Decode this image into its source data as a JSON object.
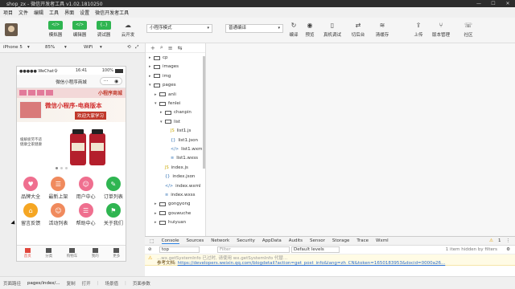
{
  "window": {
    "title": "shop_zx - 微信开发者工具 v1.02.1810250",
    "controls": [
      "—",
      "☐",
      "✕"
    ]
  },
  "menubar": [
    "项目",
    "文件",
    "编辑",
    "工具",
    "界面",
    "设置",
    "微信开发者工具"
  ],
  "toolbar": {
    "simulator": "模拟器",
    "editor": "编辑器",
    "debugger": "调试器",
    "cloud": "云开发",
    "mode_select": "小程序模式",
    "compile_select": "普通编译",
    "compile": "编译",
    "preview": "预览",
    "remote_debug": "真机调试",
    "background": "切后台",
    "clear_cache": "清缓存",
    "upload": "上传",
    "version": "版本管理",
    "community": "社区",
    "icons": {
      "simulator": "</>",
      "editor": "</>",
      "debugger": "{..}"
    }
  },
  "device_bar": {
    "device": "iPhone 5",
    "zoom": "85%",
    "network": "WiFi"
  },
  "phone": {
    "status_left": "●●●●● WeChat令",
    "status_time": "16:41",
    "status_right": "100%",
    "nav_title": "微信小程序商城",
    "banner_small": "小程序商城",
    "banner_title": "微信小程序-电商版本",
    "banner_button": "欢迎大家学习",
    "product_text": "缓解疲劳不适 健康全家健康",
    "grid": [
      {
        "label": "品牌大全",
        "color": "#ef6f8f",
        "glyph": "♥"
      },
      {
        "label": "最新上架",
        "color": "#f08a5d",
        "glyph": "☰"
      },
      {
        "label": "用户中心",
        "color": "#ef6f8f",
        "glyph": "☺"
      },
      {
        "label": "订单列表",
        "color": "#2fb551",
        "glyph": "✎"
      },
      {
        "label": "留言反馈",
        "color": "#f5a623",
        "glyph": "⌂"
      },
      {
        "label": "活动列表",
        "color": "#f08a5d",
        "glyph": "☺"
      },
      {
        "label": "帮助中心",
        "color": "#ef6f8f",
        "glyph": "☰"
      },
      {
        "label": "关于我们",
        "color": "#2fb551",
        "glyph": "⚑"
      }
    ],
    "tabs": [
      "首页",
      "分类",
      "购物车",
      "我的",
      "更多"
    ]
  },
  "filetree": {
    "tool_icons": [
      "+",
      "⌕",
      "≡",
      "⇆"
    ],
    "items": [
      {
        "label": "cp",
        "type": "folder",
        "caret": "▸",
        "indent": 0
      },
      {
        "label": "images",
        "type": "folder",
        "caret": "▸",
        "indent": 0
      },
      {
        "label": "img",
        "type": "folder",
        "caret": "▸",
        "indent": 0
      },
      {
        "label": "pages",
        "type": "folder",
        "caret": "▾",
        "indent": 0
      },
      {
        "label": "anli",
        "type": "folder",
        "caret": "▸",
        "indent": 1
      },
      {
        "label": "fenlei",
        "type": "folder",
        "caret": "▾",
        "indent": 1
      },
      {
        "label": "chanpin",
        "type": "folder",
        "caret": "▸",
        "indent": 2
      },
      {
        "label": "list",
        "type": "folder",
        "caret": "▾",
        "indent": 2
      },
      {
        "label": "list1.js",
        "type": "js",
        "caret": "",
        "indent": 3
      },
      {
        "label": "list1.json",
        "type": "json",
        "caret": "",
        "indent": 3
      },
      {
        "label": "list1.wxml",
        "type": "wxml",
        "caret": "",
        "indent": 3
      },
      {
        "label": "list1.wxss",
        "type": "wxss",
        "caret": "",
        "indent": 3
      },
      {
        "label": "index.js",
        "type": "js",
        "caret": "",
        "indent": 2
      },
      {
        "label": "index.json",
        "type": "json",
        "caret": "",
        "indent": 2
      },
      {
        "label": "index.wxml",
        "type": "wxml",
        "caret": "",
        "indent": 2
      },
      {
        "label": "index.wxss",
        "type": "wxss",
        "caret": "",
        "indent": 2
      },
      {
        "label": "gongyong",
        "type": "folder",
        "caret": "▸",
        "indent": 1
      },
      {
        "label": "gouwuche",
        "type": "folder",
        "caret": "▸",
        "indent": 1
      },
      {
        "label": "huiyuan",
        "type": "folder",
        "caret": "▸",
        "indent": 1
      }
    ]
  },
  "devtools": {
    "tabs": [
      "Console",
      "Sources",
      "Network",
      "Security",
      "AppData",
      "Audits",
      "Sensor",
      "Storage",
      "Trace",
      "Wxml"
    ],
    "active_tab": "Console",
    "warn_count": "1",
    "context": "top",
    "filter_placeholder": "Filter",
    "levels": "Default levels",
    "hidden_note": "1 item hidden by filters",
    "log_line1": "...wx.getSystemInfo 已过时, 请使用 wx.getSystemInfo 代替...",
    "log_prefix": "参考文档:",
    "log_link": "https://developers.weixin.qq.com/blogdetail?action=get_post_info&lang=zh_CN&token=1650183953&docid=0000a26..."
  },
  "bottombar": {
    "label": "页面路径",
    "path": "pages/index/...",
    "copy": "复制",
    "open": "打开",
    "scene": "场景值",
    "params": "页面参数"
  }
}
